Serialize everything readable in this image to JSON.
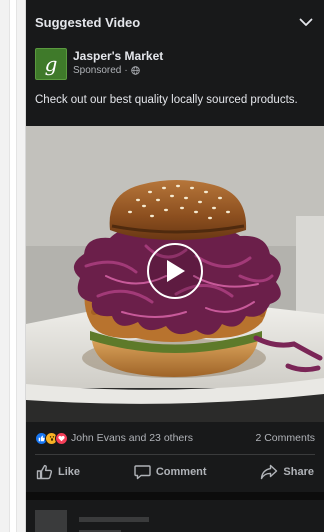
{
  "section": {
    "title": "Suggested Video"
  },
  "post": {
    "author": "Jasper's Market",
    "avatar_letter": "g",
    "sponsored_label": "Sponsored",
    "caption": "Check out our best quality locally sourced products."
  },
  "reactions": {
    "icons": [
      "like-icon",
      "wow-icon",
      "love-icon"
    ],
    "summary": "John Evans and 23 others",
    "comments": "2 Comments"
  },
  "actions": {
    "like": "Like",
    "comment": "Comment",
    "share": "Share"
  },
  "colors": {
    "background": "#18191a",
    "text_primary": "#e4e6eb",
    "text_secondary": "#b0b3b8",
    "like_blue": "#1877f2",
    "love_red": "#f33e58",
    "wow_yellow": "#f7b125",
    "avatar_green": "#3f7a2a"
  }
}
